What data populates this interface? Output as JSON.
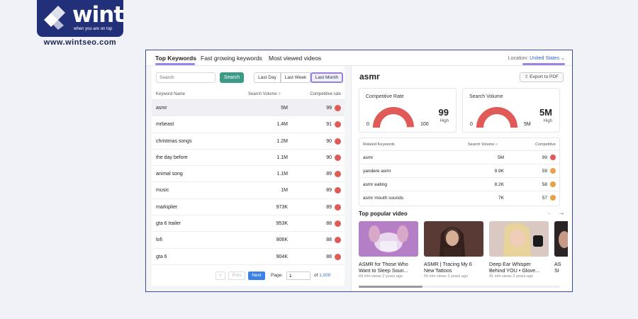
{
  "logo": {
    "word": "wint",
    "tagline": "when you are on top",
    "url": "www.wintseo.com"
  },
  "tabs": [
    {
      "label": "Top Keywords",
      "active": true
    },
    {
      "label": "Fast growing keywords",
      "active": false
    },
    {
      "label": "Most viewed videos",
      "active": false
    }
  ],
  "location": {
    "label": "Location:",
    "value": "United States",
    "icon": "chevron-down-icon"
  },
  "left": {
    "search_placeholder": "Search",
    "search_button": "Search",
    "ranges": [
      "Last Day",
      "Last Week",
      "Last Month"
    ],
    "selected_range": "Last Month",
    "columns": {
      "name": "Keyword Name",
      "volume": "Search Volume",
      "rate": "Competitive rate"
    },
    "rows": [
      {
        "keyword": "asmr",
        "volume": "5M",
        "rate": "99",
        "color": "#e05a57"
      },
      {
        "keyword": "mrbeast",
        "volume": "1.4M",
        "rate": "91",
        "color": "#e05a57"
      },
      {
        "keyword": "christmas songs",
        "volume": "1.2M",
        "rate": "90",
        "color": "#e05a57"
      },
      {
        "keyword": "the day before",
        "volume": "1.1M",
        "rate": "90",
        "color": "#e05a57"
      },
      {
        "keyword": "animal song",
        "volume": "1.1M",
        "rate": "89",
        "color": "#e05a57"
      },
      {
        "keyword": "music",
        "volume": "1M",
        "rate": "89",
        "color": "#e05a57"
      },
      {
        "keyword": "markiplier",
        "volume": "973K",
        "rate": "89",
        "color": "#e05a57"
      },
      {
        "keyword": "gta 6 trailer",
        "volume": "953K",
        "rate": "88",
        "color": "#e05a57"
      },
      {
        "keyword": "lofi",
        "volume": "906K",
        "rate": "88",
        "color": "#e05a57"
      },
      {
        "keyword": "gta 6",
        "volume": "904K",
        "rate": "88",
        "color": "#e05a57"
      }
    ],
    "pagination": {
      "first": "«",
      "prev": "Prev",
      "next": "Next",
      "page_label": "Page:",
      "page_value": "1",
      "of_label": "of",
      "total": "1,000"
    }
  },
  "right": {
    "title": "asmr",
    "export_label": "Export to PDF",
    "competitive": {
      "label": "Competitive Rate",
      "min": "0",
      "max": "100",
      "value": "99",
      "level": "High",
      "fraction": 0.99
    },
    "volume": {
      "label": "Search Volume",
      "min": "0",
      "max": "5M",
      "value": "5M",
      "level": "High",
      "fraction": 1.0
    },
    "related": {
      "columns": {
        "keyword": "Related Keywords",
        "volume": "Search Volume",
        "competitive": "Competitive"
      },
      "rows": [
        {
          "keyword": "asmr",
          "volume": "5M",
          "rate": "99",
          "color": "#e05a57"
        },
        {
          "keyword": "yandere asmr",
          "volume": "9.9K",
          "rate": "59",
          "color": "#e8a04a"
        },
        {
          "keyword": "asmr eating",
          "volume": "8.2K",
          "rate": "58",
          "color": "#e8a04a"
        },
        {
          "keyword": "asmr mouth sounds",
          "volume": "7K",
          "rate": "57",
          "color": "#e8a04a"
        }
      ]
    },
    "popular_title": "Top popular video",
    "videos": [
      {
        "title1": "ASMR for Those Who",
        "title2": "Want to Sleep Soun...",
        "meta": "69 mln views 2 years ago"
      },
      {
        "title1": "ASMR | Tracing My 6",
        "title2": "New Tattoos",
        "meta": "50 mln views 2 years ago"
      },
      {
        "title1": "Deep Ear Whisper",
        "title2": "Behind YOU • Glove...",
        "meta": "41 mln views 2 years ago"
      },
      {
        "title1": "AS",
        "title2": "SI",
        "meta": ""
      }
    ]
  }
}
